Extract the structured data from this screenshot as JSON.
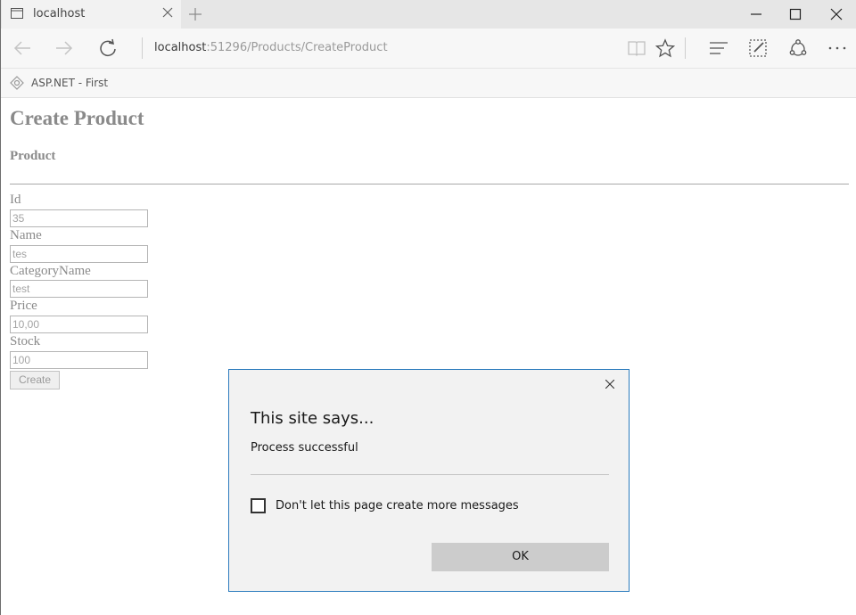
{
  "browser": {
    "tab_title": "localhost",
    "address_host": "localhost",
    "address_path": ":51296/Products/CreateProduct",
    "favorite_label": "ASP.NET - First",
    "icons": [
      "tab-page-icon",
      "close-icon",
      "plus-icon",
      "minimize-icon",
      "maximize-icon",
      "close-window-icon",
      "back-arrow-icon",
      "forward-arrow-icon",
      "refresh-icon",
      "reading-view-icon",
      "star-icon",
      "hub-icon",
      "web-note-icon",
      "share-icon",
      "more-icon",
      "site-favicon"
    ]
  },
  "page": {
    "title": "Create Product",
    "subtitle": "Product",
    "fields": [
      {
        "label": "Id",
        "value": "35"
      },
      {
        "label": "Name",
        "value": "tes"
      },
      {
        "label": "CategoryName",
        "value": "test"
      },
      {
        "label": "Price",
        "value": "10,00"
      },
      {
        "label": "Stock",
        "value": "100"
      }
    ],
    "create_label": "Create"
  },
  "dialog": {
    "title": "This site says...",
    "message": "Process successful",
    "checkbox_label": "Don't let this page create more messages",
    "ok_label": "OK",
    "accent": "#2b7bbd"
  }
}
